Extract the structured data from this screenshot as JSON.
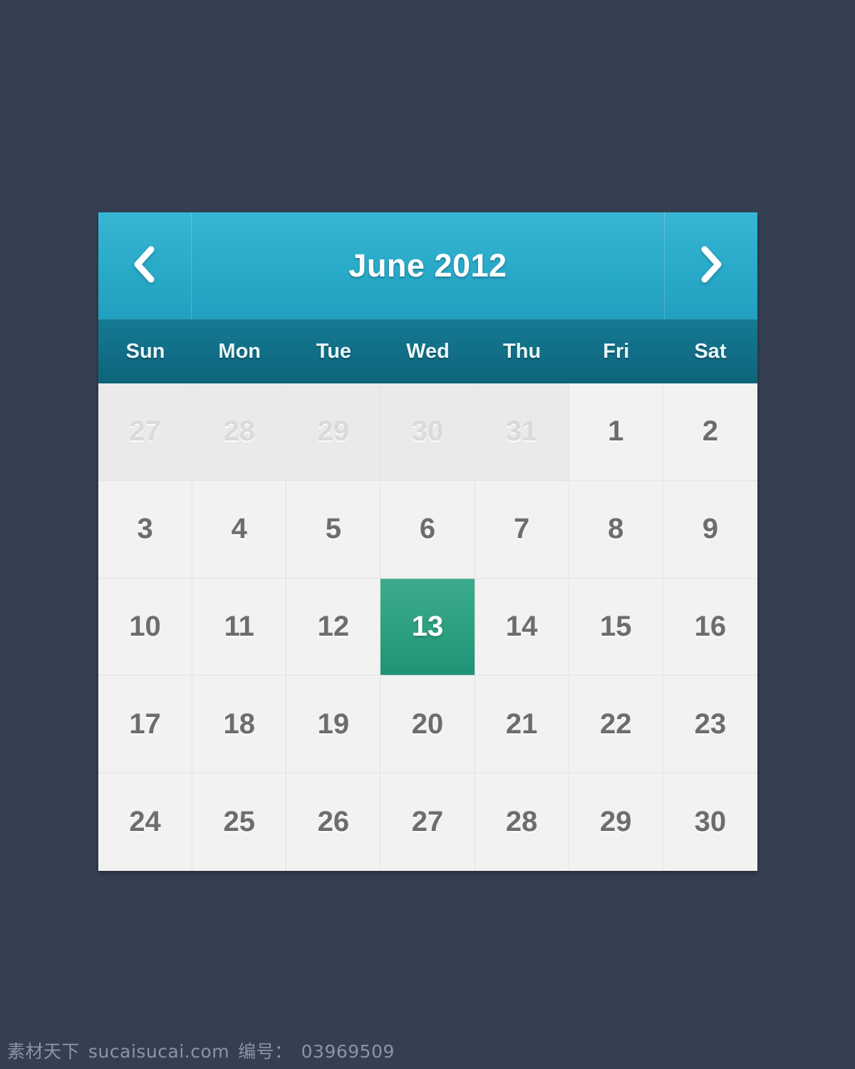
{
  "background_color": "#353f52",
  "header": {
    "title": "June 2012",
    "month": "June",
    "year": "2012",
    "prev_label": "‹",
    "next_label": "›",
    "prev_icon": "chevron-left-icon",
    "next_icon": "chevron-right-icon",
    "gradient_top": "#38b6d4",
    "gradient_bottom": "#229fc0"
  },
  "weekdays": [
    {
      "label": "Sun"
    },
    {
      "label": "Mon"
    },
    {
      "label": "Tue"
    },
    {
      "label": "Wed"
    },
    {
      "label": "Thu"
    },
    {
      "label": "Fri"
    },
    {
      "label": "Sat"
    }
  ],
  "weekday_bar_color": "#116e86",
  "selected_color": "#2ea182",
  "day_text_color": "#6d6d6d",
  "muted_text_color": "#dadada",
  "days": [
    {
      "label": "27",
      "muted": true,
      "selected": false
    },
    {
      "label": "28",
      "muted": true,
      "selected": false
    },
    {
      "label": "29",
      "muted": true,
      "selected": false
    },
    {
      "label": "30",
      "muted": true,
      "selected": false
    },
    {
      "label": "31",
      "muted": true,
      "selected": false
    },
    {
      "label": "1",
      "muted": false,
      "selected": false
    },
    {
      "label": "2",
      "muted": false,
      "selected": false
    },
    {
      "label": "3",
      "muted": false,
      "selected": false
    },
    {
      "label": "4",
      "muted": false,
      "selected": false
    },
    {
      "label": "5",
      "muted": false,
      "selected": false
    },
    {
      "label": "6",
      "muted": false,
      "selected": false
    },
    {
      "label": "7",
      "muted": false,
      "selected": false
    },
    {
      "label": "8",
      "muted": false,
      "selected": false
    },
    {
      "label": "9",
      "muted": false,
      "selected": false
    },
    {
      "label": "10",
      "muted": false,
      "selected": false
    },
    {
      "label": "11",
      "muted": false,
      "selected": false
    },
    {
      "label": "12",
      "muted": false,
      "selected": false
    },
    {
      "label": "13",
      "muted": false,
      "selected": true
    },
    {
      "label": "14",
      "muted": false,
      "selected": false
    },
    {
      "label": "15",
      "muted": false,
      "selected": false
    },
    {
      "label": "16",
      "muted": false,
      "selected": false
    },
    {
      "label": "17",
      "muted": false,
      "selected": false
    },
    {
      "label": "18",
      "muted": false,
      "selected": false
    },
    {
      "label": "19",
      "muted": false,
      "selected": false
    },
    {
      "label": "20",
      "muted": false,
      "selected": false
    },
    {
      "label": "21",
      "muted": false,
      "selected": false
    },
    {
      "label": "22",
      "muted": false,
      "selected": false
    },
    {
      "label": "23",
      "muted": false,
      "selected": false
    },
    {
      "label": "24",
      "muted": false,
      "selected": false
    },
    {
      "label": "25",
      "muted": false,
      "selected": false
    },
    {
      "label": "26",
      "muted": false,
      "selected": false
    },
    {
      "label": "27",
      "muted": false,
      "selected": false
    },
    {
      "label": "28",
      "muted": false,
      "selected": false
    },
    {
      "label": "29",
      "muted": false,
      "selected": false
    },
    {
      "label": "30",
      "muted": false,
      "selected": false
    }
  ],
  "watermark": {
    "site_cn": "素材天下",
    "site_url": "sucaisucai.com",
    "id_label": "编号：",
    "id_value": "03969509"
  }
}
